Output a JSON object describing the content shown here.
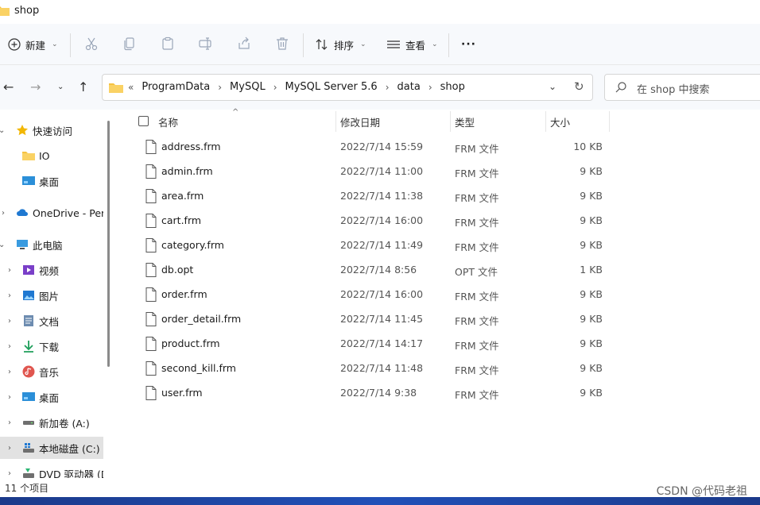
{
  "window": {
    "title": "shop"
  },
  "toolbar": {
    "new_label": "新建",
    "sort_label": "排序",
    "view_label": "查看",
    "more_label": "···"
  },
  "address": {
    "overflow": "«",
    "crumbs": [
      "ProgramData",
      "MySQL",
      "MySQL Server 5.6",
      "data",
      "shop"
    ]
  },
  "search": {
    "placeholder": "在 shop 中搜索"
  },
  "sidebar": {
    "items": [
      {
        "label": "快速访问",
        "icon": "star-icon"
      },
      {
        "label": "IO",
        "icon": "folder-icon"
      },
      {
        "label": "桌面",
        "icon": "desktop-icon"
      },
      {
        "label": "OneDrive - Pers",
        "icon": "cloud-icon"
      },
      {
        "label": "此电脑",
        "icon": "computer-icon"
      },
      {
        "label": "视频",
        "icon": "video-icon"
      },
      {
        "label": "图片",
        "icon": "picture-icon"
      },
      {
        "label": "文档",
        "icon": "document-icon"
      },
      {
        "label": "下载",
        "icon": "download-icon"
      },
      {
        "label": "音乐",
        "icon": "music-icon"
      },
      {
        "label": "桌面",
        "icon": "desktop-icon"
      },
      {
        "label": "新加卷 (A:)",
        "icon": "drive-icon"
      },
      {
        "label": "本地磁盘 (C:)",
        "icon": "system-drive-icon"
      },
      {
        "label": "DVD 驱动器 (D",
        "icon": "dvd-icon"
      }
    ]
  },
  "columns": {
    "name": "名称",
    "date": "修改日期",
    "type": "类型",
    "size": "大小"
  },
  "files": [
    {
      "name": "address.frm",
      "date": "2022/7/14 15:59",
      "type": "FRM 文件",
      "size": "10 KB"
    },
    {
      "name": "admin.frm",
      "date": "2022/7/14 11:00",
      "type": "FRM 文件",
      "size": "9 KB"
    },
    {
      "name": "area.frm",
      "date": "2022/7/14 11:38",
      "type": "FRM 文件",
      "size": "9 KB"
    },
    {
      "name": "cart.frm",
      "date": "2022/7/14 16:00",
      "type": "FRM 文件",
      "size": "9 KB"
    },
    {
      "name": "category.frm",
      "date": "2022/7/14 11:49",
      "type": "FRM 文件",
      "size": "9 KB"
    },
    {
      "name": "db.opt",
      "date": "2022/7/14 8:56",
      "type": "OPT 文件",
      "size": "1 KB"
    },
    {
      "name": "order.frm",
      "date": "2022/7/14 16:00",
      "type": "FRM 文件",
      "size": "9 KB"
    },
    {
      "name": "order_detail.frm",
      "date": "2022/7/14 11:45",
      "type": "FRM 文件",
      "size": "9 KB"
    },
    {
      "name": "product.frm",
      "date": "2022/7/14 14:17",
      "type": "FRM 文件",
      "size": "9 KB"
    },
    {
      "name": "second_kill.frm",
      "date": "2022/7/14 11:48",
      "type": "FRM 文件",
      "size": "9 KB"
    },
    {
      "name": "user.frm",
      "date": "2022/7/14 9:38",
      "type": "FRM 文件",
      "size": "9 KB"
    }
  ],
  "status": {
    "count": "11 个项目"
  },
  "watermark": "CSDN @代码老祖",
  "colors": {
    "folder": "#f5c242",
    "accent": "#0067c0",
    "selected": "#e2e2e2",
    "toolbar_bg": "#f7f9fc"
  }
}
